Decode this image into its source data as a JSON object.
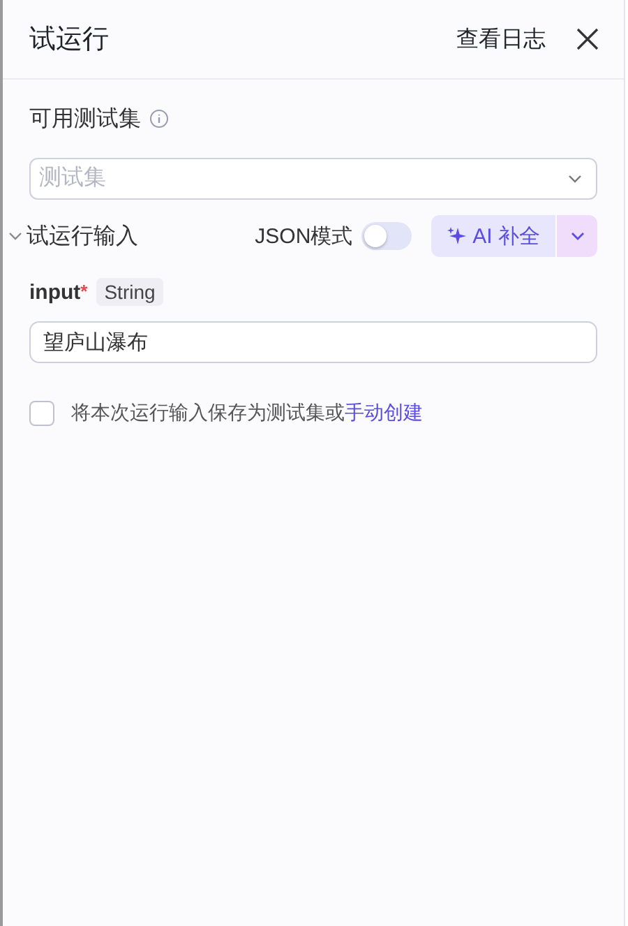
{
  "header": {
    "title": "试运行",
    "log_link": "查看日志"
  },
  "test_set": {
    "label": "可用测试集",
    "placeholder": "测试集"
  },
  "run_input": {
    "title": "试运行输入",
    "expanded": true,
    "json_mode_label": "JSON模式",
    "json_mode_on": false,
    "ai_button": "AI 补全"
  },
  "fields": [
    {
      "name": "input",
      "required_mark": "*",
      "type": "String",
      "value": "望庐山瀑布"
    }
  ],
  "save_option": {
    "checked": false,
    "text": "将本次运行输入保存为测试集或",
    "link": "手动创建"
  }
}
